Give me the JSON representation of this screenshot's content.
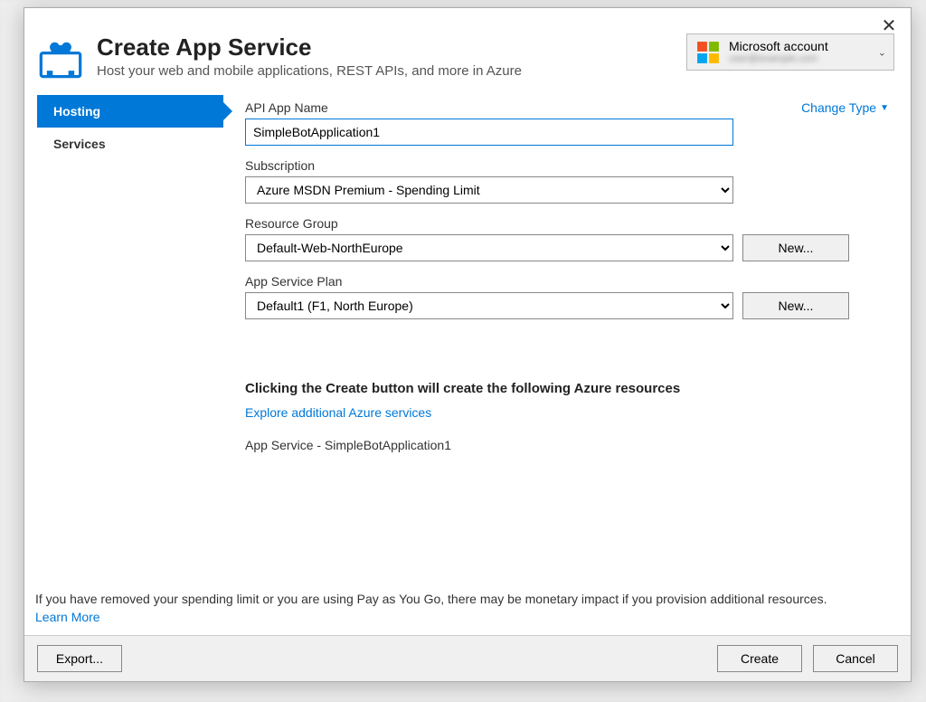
{
  "dialog": {
    "title": "Create App Service",
    "subtitle": "Host your web and mobile applications, REST APIs, and more in Azure"
  },
  "account": {
    "label": "Microsoft account",
    "email": "user@example.com"
  },
  "sidebar": {
    "items": [
      {
        "label": "Hosting",
        "active": true
      },
      {
        "label": "Services",
        "active": false
      }
    ]
  },
  "form": {
    "api_name_label": "API App Name",
    "change_type": "Change Type",
    "api_name_value": "SimpleBotApplication1",
    "subscription_label": "Subscription",
    "subscription_value": "Azure MSDN Premium - Spending Limit",
    "resource_group_label": "Resource Group",
    "resource_group_value": "Default-Web-NorthEurope",
    "resource_group_new": "New...",
    "plan_label": "App Service Plan",
    "plan_value": "Default1 (F1, North Europe)",
    "plan_new": "New..."
  },
  "summary": {
    "heading": "Clicking the Create button will create the following Azure resources",
    "explore_link": "Explore additional Azure services",
    "resource_line": "App Service - SimpleBotApplication1"
  },
  "footer": {
    "note": "If you have removed your spending limit or you are using Pay as You Go, there may be monetary impact if you provision additional resources.",
    "learn_more": "Learn More",
    "export": "Export...",
    "create": "Create",
    "cancel": "Cancel"
  }
}
